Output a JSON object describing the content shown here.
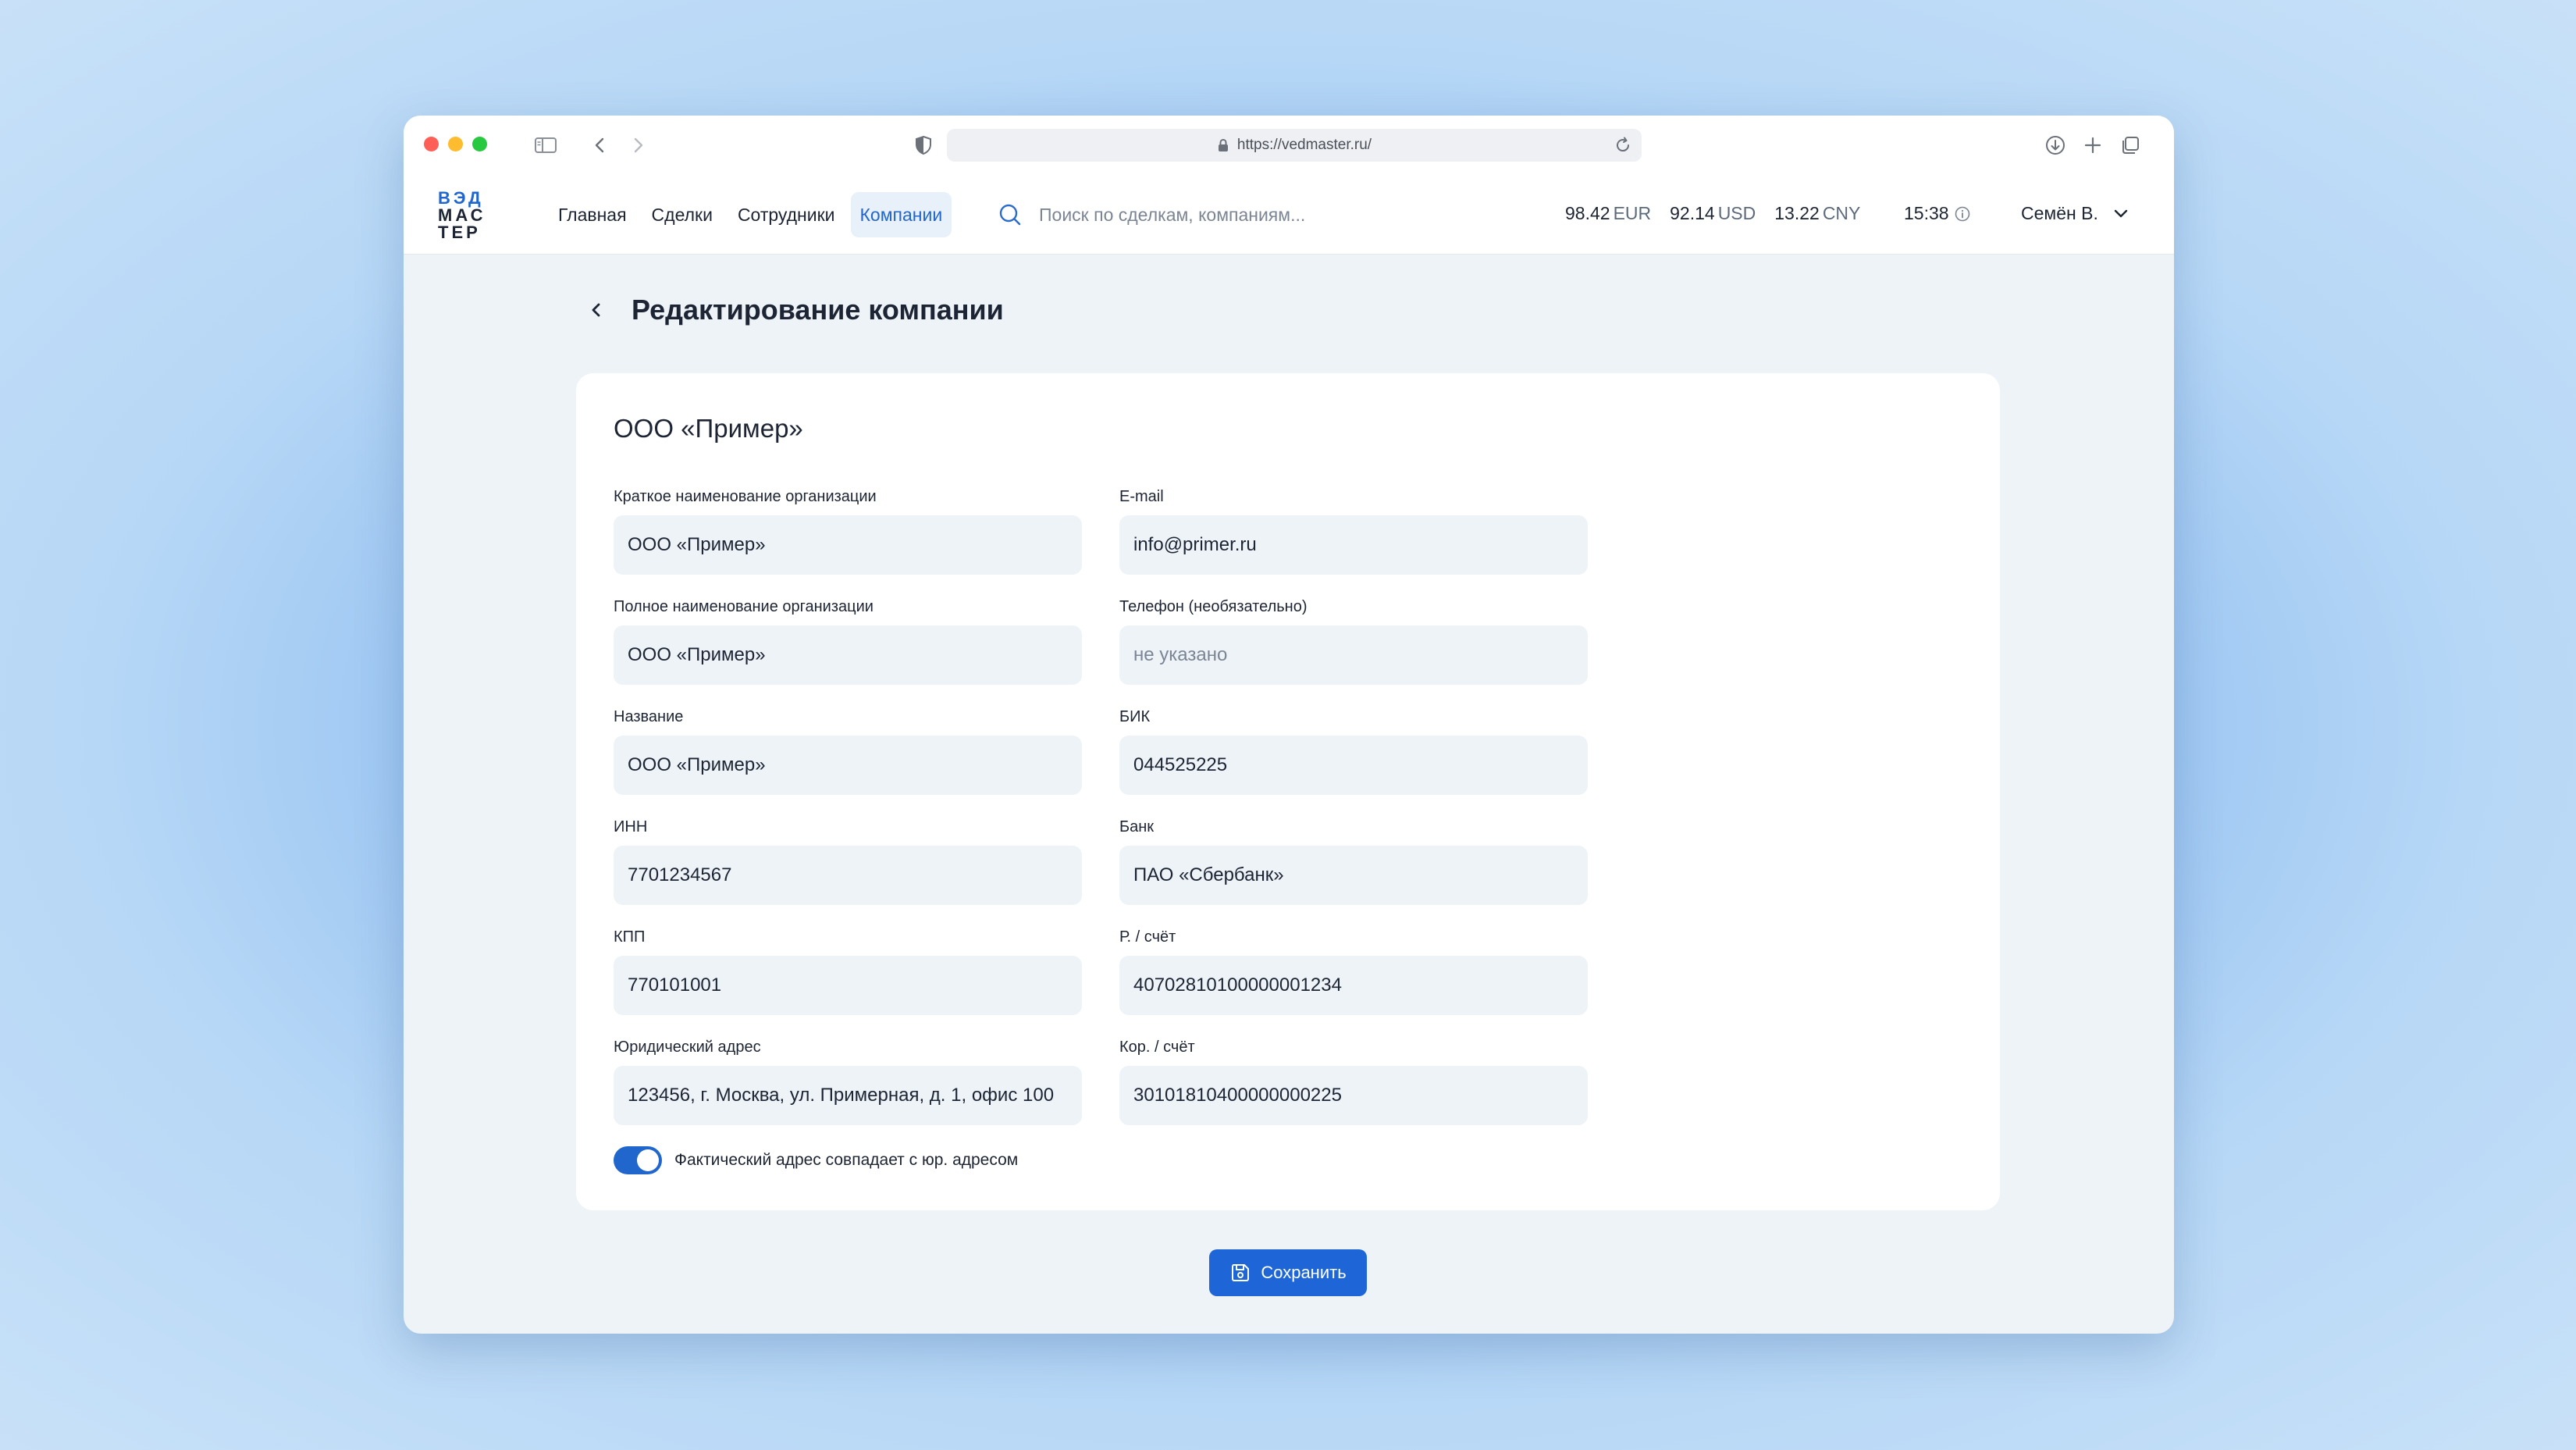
{
  "browser": {
    "url": "https://vedmaster.ru/"
  },
  "header": {
    "logo_text": [
      "ВЭД",
      "МАС",
      "ТЕР"
    ],
    "nav": [
      {
        "label": "Главная"
      },
      {
        "label": "Сделки"
      },
      {
        "label": "Сотрудники"
      },
      {
        "label": "Компании",
        "active": true
      }
    ],
    "search_placeholder": "Поиск по сделкам, компаниям...",
    "rates": [
      {
        "value": "98.42",
        "currency": "EUR"
      },
      {
        "value": "92.14",
        "currency": "USD"
      },
      {
        "value": "13.22",
        "currency": "CNY"
      }
    ],
    "time": "15:38",
    "user_name": "Семён В."
  },
  "page": {
    "title": "Редактирование компании",
    "card_title": "ООО «Пример»",
    "left_fields": [
      {
        "label": "Краткое наименование организации",
        "value": "ООО «Пример»"
      },
      {
        "label": "Полное наименование организации",
        "value": "ООО «Пример»"
      },
      {
        "label": "Название",
        "value": "ООО «Пример»"
      },
      {
        "label": "ИНН",
        "value": "7701234567"
      },
      {
        "label": "КПП",
        "value": "770101001"
      },
      {
        "label": "Юридический адрес",
        "value": "123456, г. Москва, ул. Примерная, д. 1, офис 100"
      }
    ],
    "right_fields": [
      {
        "label": "E-mail",
        "value": "info@primer.ru"
      },
      {
        "label": "Телефон (необязательно)",
        "value": "",
        "placeholder": "не указано"
      },
      {
        "label": "БИК",
        "value": "044525225"
      },
      {
        "label": "Банк",
        "value": "ПАО «Сбербанк»"
      },
      {
        "label": "Р. / счёт",
        "value": "40702810100000001234"
      },
      {
        "label": "Кор. / счёт",
        "value": "30101810400000000225"
      }
    ],
    "toggle": {
      "label": "Фактический адрес совпадает с юр. адресом",
      "on": true
    },
    "save_label": "Сохранить"
  },
  "colors": {
    "accent": "#1e66d8",
    "nav_active_bg": "#e8f0f9",
    "input_bg": "#eef3f8"
  },
  "icons": [
    "sidebar-icon",
    "chevron-left-icon",
    "chevron-right-icon",
    "shield-icon",
    "lock-icon",
    "reload-icon",
    "download-icon",
    "plus-icon",
    "tabs-icon",
    "search-icon",
    "info-icon",
    "chevron-down-icon",
    "back-arrow-icon",
    "floppy-disk-icon"
  ]
}
